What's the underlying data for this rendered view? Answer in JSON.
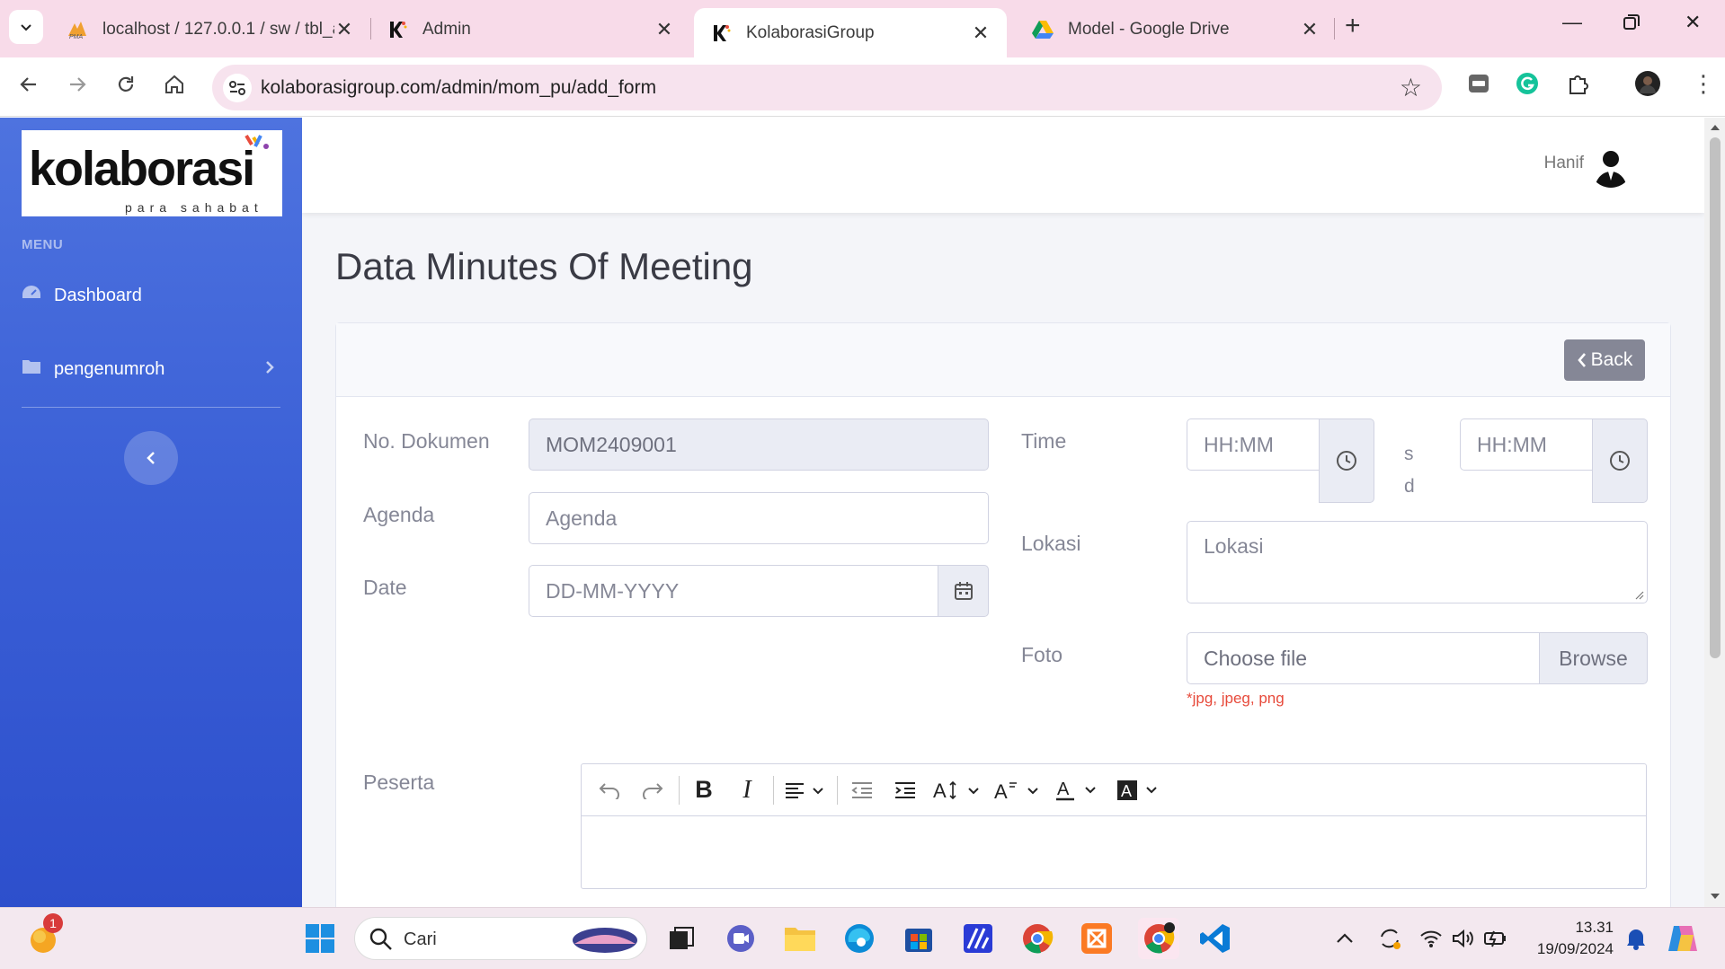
{
  "browser": {
    "tabs": [
      {
        "label": "localhost / 127.0.0.1 / sw / tbl_a",
        "favicon": "phpmyadmin-icon",
        "active": false
      },
      {
        "label": "Admin",
        "favicon": "kolaborasi-icon",
        "active": false
      },
      {
        "label": "KolaborasiGroup",
        "favicon": "kolaborasi-icon",
        "active": true
      },
      {
        "label": "Model - Google Drive",
        "favicon": "google-drive-icon",
        "active": false
      }
    ],
    "url": "kolaborasigroup.com/admin/mom_pu/add_form"
  },
  "sidebar": {
    "logo_text": "kolaborasi",
    "logo_tagline": "para sahabat",
    "menu_heading": "MENU",
    "items": [
      {
        "label": "Dashboard",
        "icon": "dashboard-icon"
      },
      {
        "label": "pengenumroh",
        "icon": "folder-icon"
      }
    ]
  },
  "topbar": {
    "user_name": "Hanif"
  },
  "page": {
    "title": "Data Minutes Of Meeting"
  },
  "form": {
    "back_label": "Back",
    "no_dokumen": {
      "label": "No. Dokumen",
      "value": "MOM2409001"
    },
    "agenda": {
      "label": "Agenda",
      "placeholder": "Agenda"
    },
    "date": {
      "label": "Date",
      "placeholder": "DD-MM-YYYY"
    },
    "time": {
      "label": "Time",
      "start_placeholder": "HH:MM",
      "end_placeholder": "HH:MM",
      "separator": "s d"
    },
    "lokasi": {
      "label": "Lokasi",
      "placeholder": "Lokasi"
    },
    "foto": {
      "label": "Foto",
      "placeholder": "Choose file",
      "browse": "Browse",
      "note": "*jpg, jpeg, png"
    },
    "peserta": {
      "label": "Peserta"
    }
  },
  "taskbar": {
    "search_label": "Cari",
    "notification_badge": "1",
    "time": "13.31",
    "date": "19/09/2024"
  },
  "colors": {
    "sidebar": "#4e73df",
    "back_button": "#858796",
    "note_red": "#e74a3b",
    "tabbar": "#f8dbe9"
  }
}
